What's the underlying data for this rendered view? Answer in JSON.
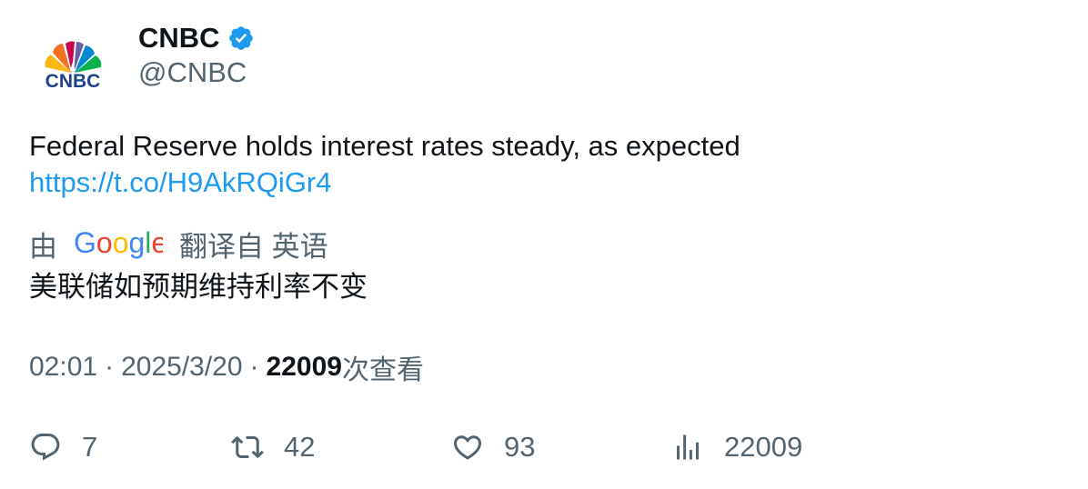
{
  "author": {
    "display_name": "CNBC",
    "handle": "@CNBC",
    "verified": true,
    "avatar_icon": "cnbc-peacock-logo",
    "avatar_logo_text": "CNBC"
  },
  "tweet": {
    "text": "Federal Reserve holds interest rates steady, as expected",
    "link": "https://t.co/H9AkRQiGr4"
  },
  "translation": {
    "prefix": "由",
    "provider": "Google",
    "suffix": "翻译自 英语",
    "text": "美联储如预期维持利率不变"
  },
  "meta": {
    "time": "02:01",
    "separator": "·",
    "date": "2025/3/20",
    "views_count": "22009",
    "views_label": "次查看"
  },
  "actions": {
    "replies": "7",
    "retweets": "42",
    "likes": "93",
    "views": "22009"
  },
  "colors": {
    "link": "#1d9bf0",
    "secondary_text": "#536471",
    "primary_text": "#0f1419",
    "verified_badge": "#1d9bf0"
  }
}
